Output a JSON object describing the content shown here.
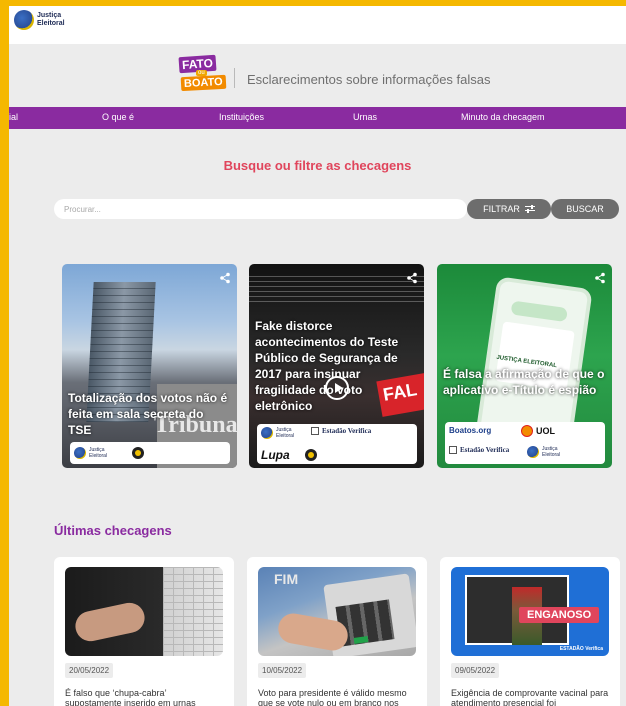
{
  "header": {
    "logo_text_1": "Justiça",
    "logo_text_2": "Eleitoral"
  },
  "brand": {
    "logo_word_1": "FATO",
    "logo_word_mid": "ou",
    "logo_word_2": "BOATO",
    "subtitle": "Esclarecimentos sobre informações falsas"
  },
  "nav": {
    "items": [
      {
        "label": "ial"
      },
      {
        "label": "O que é"
      },
      {
        "label": "Instituições"
      },
      {
        "label": "Urnas"
      },
      {
        "label": "Minuto da checagem"
      }
    ]
  },
  "search": {
    "title": "Busque ou filtre as checagens",
    "placeholder": "Procurar...",
    "filter_label": "FILTRAR",
    "search_label": "BUSCAR"
  },
  "featured": [
    {
      "title": "Totalização dos votos não é feita em sala secreta do TSE",
      "bg_text": "Tribunal",
      "agencies": [
        "Justiça Eleitoral"
      ]
    },
    {
      "title": "Fake distorce acontecimentos do Teste Público de Segurança de 2017 para insinuar fragilidade do voto eletrônico",
      "stamp": "FAL",
      "agencies": [
        "Justiça Eleitoral",
        "Estadão Verifica",
        "Lupa"
      ]
    },
    {
      "title": "É falsa a afirmação de que o aplicativo e-Título é espião",
      "phone_label": "JUSTIÇA ELEITORAL",
      "agencies": [
        "Boatos.org",
        "UOL",
        "Estadão Verifica",
        "Justiça Eleitoral"
      ]
    }
  ],
  "latest": {
    "section_title": "Últimas checagens",
    "items": [
      {
        "date": "20/05/2022",
        "title": "É falso que ‘chupa-cabra’ supostamente inserido em urnas"
      },
      {
        "date": "10/05/2022",
        "title": "Voto para presidente é válido mesmo que se vote nulo ou em branco nos demais cargos",
        "img_word": "FIM"
      },
      {
        "date": "09/05/2022",
        "title": "Exigência de comprovante vacinal para atendimento presencial foi",
        "img_label": "ENGANOSO",
        "img_tag": "ESTADÃO Verifica"
      }
    ]
  },
  "colors": {
    "page_border": "#f5b800",
    "nav_bg": "#8a2ba0",
    "accent_red": "#e0455c",
    "button_gray": "#6d6d6d"
  }
}
